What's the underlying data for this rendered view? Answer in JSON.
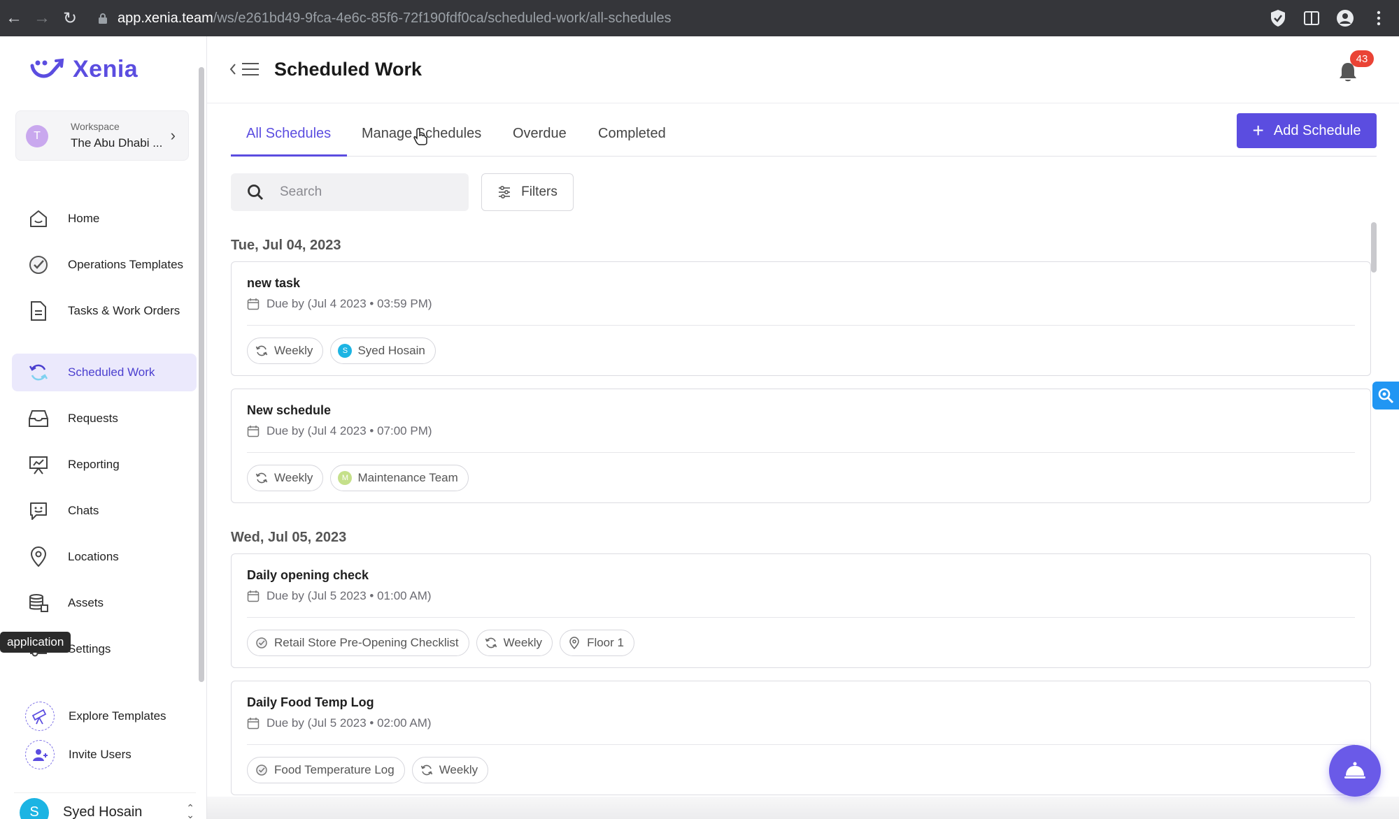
{
  "browser": {
    "url_host": "app.xenia.team",
    "url_path": "/ws/e261bd49-9fca-4e6c-85f6-72f190fdf0ca/scheduled-work/all-schedules"
  },
  "sidebar": {
    "logo_text": "Xenia",
    "workspace": {
      "label": "Workspace",
      "name": "The Abu Dhabi ...",
      "avatar": "T"
    },
    "items": [
      {
        "label": "Home",
        "icon": "home-icon"
      },
      {
        "label": "Operations Templates",
        "icon": "check-circle-icon"
      },
      {
        "label": "Tasks & Work Orders",
        "icon": "document-icon"
      },
      {
        "label": "Scheduled Work",
        "icon": "recurring-icon",
        "active": true
      },
      {
        "label": "Requests",
        "icon": "inbox-icon"
      },
      {
        "label": "Reporting",
        "icon": "presentation-chart-icon"
      },
      {
        "label": "Chats",
        "icon": "chat-smile-icon"
      },
      {
        "label": "Locations",
        "icon": "location-pin-icon"
      },
      {
        "label": "Assets",
        "icon": "database-icon"
      },
      {
        "label": "Settings",
        "icon": "sliders-icon"
      }
    ],
    "tooltip": "application",
    "extra": [
      {
        "label": "Explore Templates",
        "icon": "telescope-icon"
      },
      {
        "label": "Invite Users",
        "icon": "add-user-icon"
      }
    ],
    "user": {
      "name": "Syed Hosain",
      "initial": "S"
    }
  },
  "header": {
    "title": "Scheduled Work",
    "notification_count": "43"
  },
  "tabs": [
    {
      "label": "All Schedules",
      "active": true
    },
    {
      "label": "Manage Schedules"
    },
    {
      "label": "Overdue"
    },
    {
      "label": "Completed"
    }
  ],
  "add_button": "Add Schedule",
  "search": {
    "placeholder": "Search"
  },
  "filters_label": "Filters",
  "groups": [
    {
      "date": "Tue, Jul 04, 2023",
      "schedules": [
        {
          "title": "new task",
          "due": "Due by (Jul 4 2023 • 03:59 PM)",
          "chips": [
            {
              "type": "recurrence",
              "label": "Weekly"
            },
            {
              "type": "assignee",
              "label": "Syed Hosain",
              "initial": "S",
              "color": "#1cb4e3"
            }
          ]
        },
        {
          "title": "New schedule",
          "due": "Due by (Jul 4 2023 • 07:00 PM)",
          "chips": [
            {
              "type": "recurrence",
              "label": "Weekly"
            },
            {
              "type": "assignee",
              "label": "Maintenance Team",
              "initial": "M",
              "color": "#c5e08a"
            }
          ]
        }
      ]
    },
    {
      "date": "Wed, Jul 05, 2023",
      "schedules": [
        {
          "title": "Daily opening check",
          "due": "Due by (Jul 5 2023 • 01:00 AM)",
          "chips": [
            {
              "type": "template",
              "label": "Retail Store Pre-Opening Checklist"
            },
            {
              "type": "recurrence",
              "label": "Weekly"
            },
            {
              "type": "location",
              "label": "Floor 1"
            }
          ]
        },
        {
          "title": "Daily Food Temp Log",
          "due": "Due by (Jul 5 2023 • 02:00 AM)",
          "chips": [
            {
              "type": "template",
              "label": "Food Temperature Log"
            },
            {
              "type": "recurrence",
              "label": "Weekly"
            }
          ]
        }
      ]
    }
  ],
  "colors": {
    "accent": "#5b4de0",
    "badge": "#ea4335"
  }
}
